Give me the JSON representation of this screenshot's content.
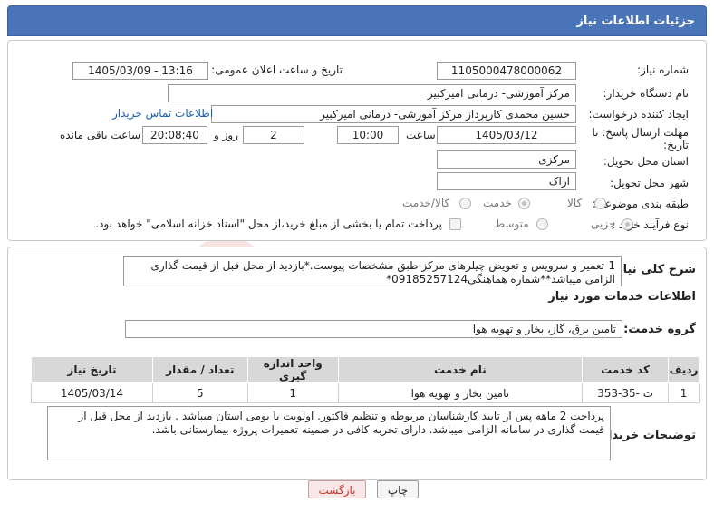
{
  "header": {
    "title": "جزئیات اطلاعات نیاز"
  },
  "fields": {
    "need_number_label": "شماره نیاز:",
    "need_number": "1105000478000062",
    "announce_label": "تاریخ و ساعت اعلان عمومی:",
    "announce_value": "1405/03/09 - 13:16",
    "buyer_org_label": "نام دستگاه خریدار:",
    "buyer_org": "مرکز آموزشی- درمانی امیرکبیر",
    "creator_label": "ایجاد کننده درخواست:",
    "creator": "حسین  محمدی کارپرداز مرکز آموزشی- درمانی امیرکبیر",
    "contact_link": "اطلاعات تماس خریدار",
    "deadline_label_1": "مهلت ارسال پاسخ: تا",
    "deadline_label_2": "تاریخ:",
    "deadline_date": "1405/03/12",
    "time_label": "ساعت",
    "deadline_time": "10:00",
    "days_value": "2",
    "days_label": "روز و",
    "remaining_time": "20:08:40",
    "remaining_label": "ساعت باقی مانده",
    "province_label": "استان محل تحویل:",
    "province": "مرکزی",
    "city_label": "شهر محل تحویل:",
    "city": "اراک",
    "category_label": "طبقه بندی موضوعی:",
    "category_options": [
      "کالا",
      "خدمت",
      "کالا/خدمت"
    ],
    "purchase_label": "نوع فرآیند خرید :",
    "purchase_options": [
      "جزیی",
      "متوسط"
    ],
    "payment_note": "پرداخت تمام یا بخشی از مبلغ خرید،از محل \"اسناد خزانه اسلامی\" خواهد بود."
  },
  "summary": {
    "label": "شرح کلی نیاز:",
    "text": "1-تعمیر و سرویس و تعویض چیلرهای مرکز طبق مشخصات پیوست.*بازدید از محل قبل از قیمت گذاری الزامی میباشد**شماره هماهنگی09185257124*"
  },
  "services": {
    "section_title": "اطلاعات خدمات مورد نیاز",
    "group_label": "گروه خدمت:",
    "group_value": "تامین برق، گاز، بخار و تهویه هوا",
    "columns": [
      "ردیف",
      "کد خدمت",
      "نام خدمت",
      "واحد اندازه گیری",
      "تعداد / مقدار",
      "تاریخ نیاز"
    ],
    "rows": [
      [
        "1",
        "ت -35-353",
        "تامین بخار و تهویه هوا",
        "1",
        "5",
        "1405/03/14"
      ]
    ]
  },
  "buyer_notes": {
    "label": "توضیحات خریدار:",
    "text": "پرداخت 2 ماهه پس از تایید کارشناسان مربوطه و تنظیم فاکتور. اولویت با بومی استان میباشد . بازدید از محل قبل از قیمت گذاری در سامانه الزامی میباشد. دارای تجربه کافی در ضمینه تعمیرات پروژه بیمارستانی باشد."
  },
  "buttons": {
    "print": "چاپ",
    "back": "بازگشت"
  },
  "watermark": {
    "text": "AriaTender.neT"
  },
  "colors": {
    "header_bg": "#4a74b8",
    "link": "#1a5fb4",
    "back_text": "#c0392b"
  }
}
